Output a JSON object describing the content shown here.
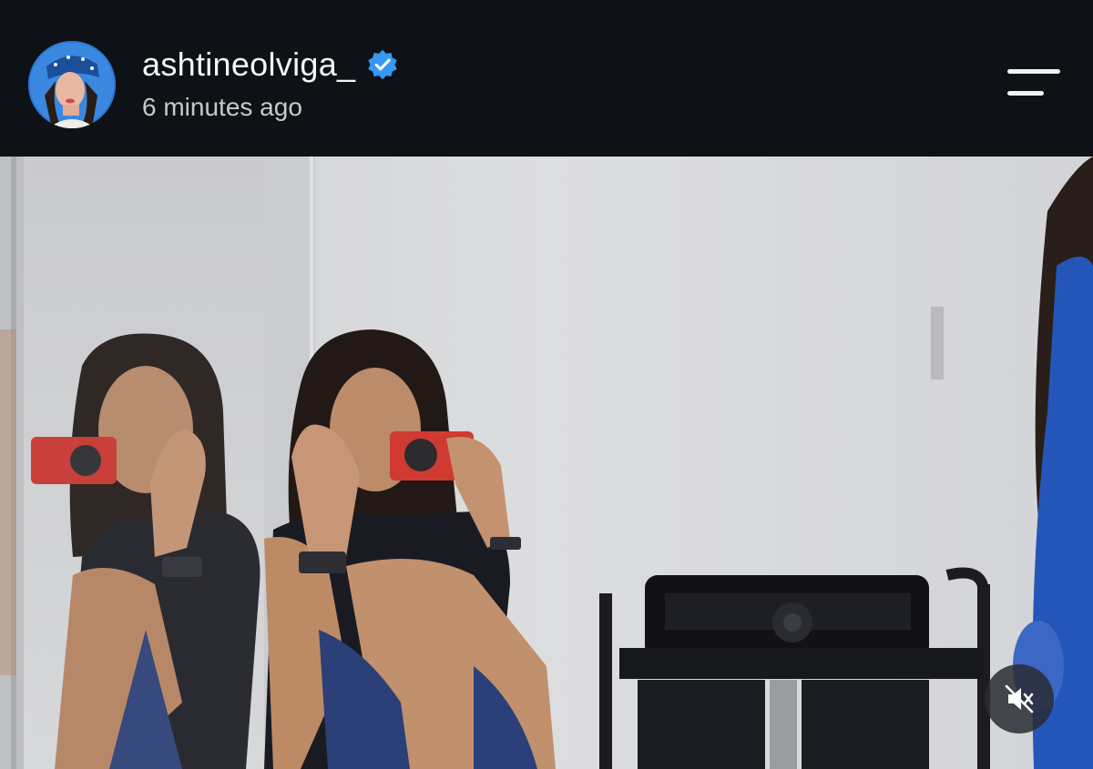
{
  "header": {
    "username": "ashtineolviga_",
    "timestamp": "6 minutes ago",
    "verified": true,
    "accent_color": "#3897f0"
  },
  "icons": {
    "avatar": "profile-avatar",
    "verified": "verified-badge-icon",
    "menu": "menu-icon",
    "mute": "muted-speaker-icon"
  },
  "video": {
    "muted": true
  }
}
